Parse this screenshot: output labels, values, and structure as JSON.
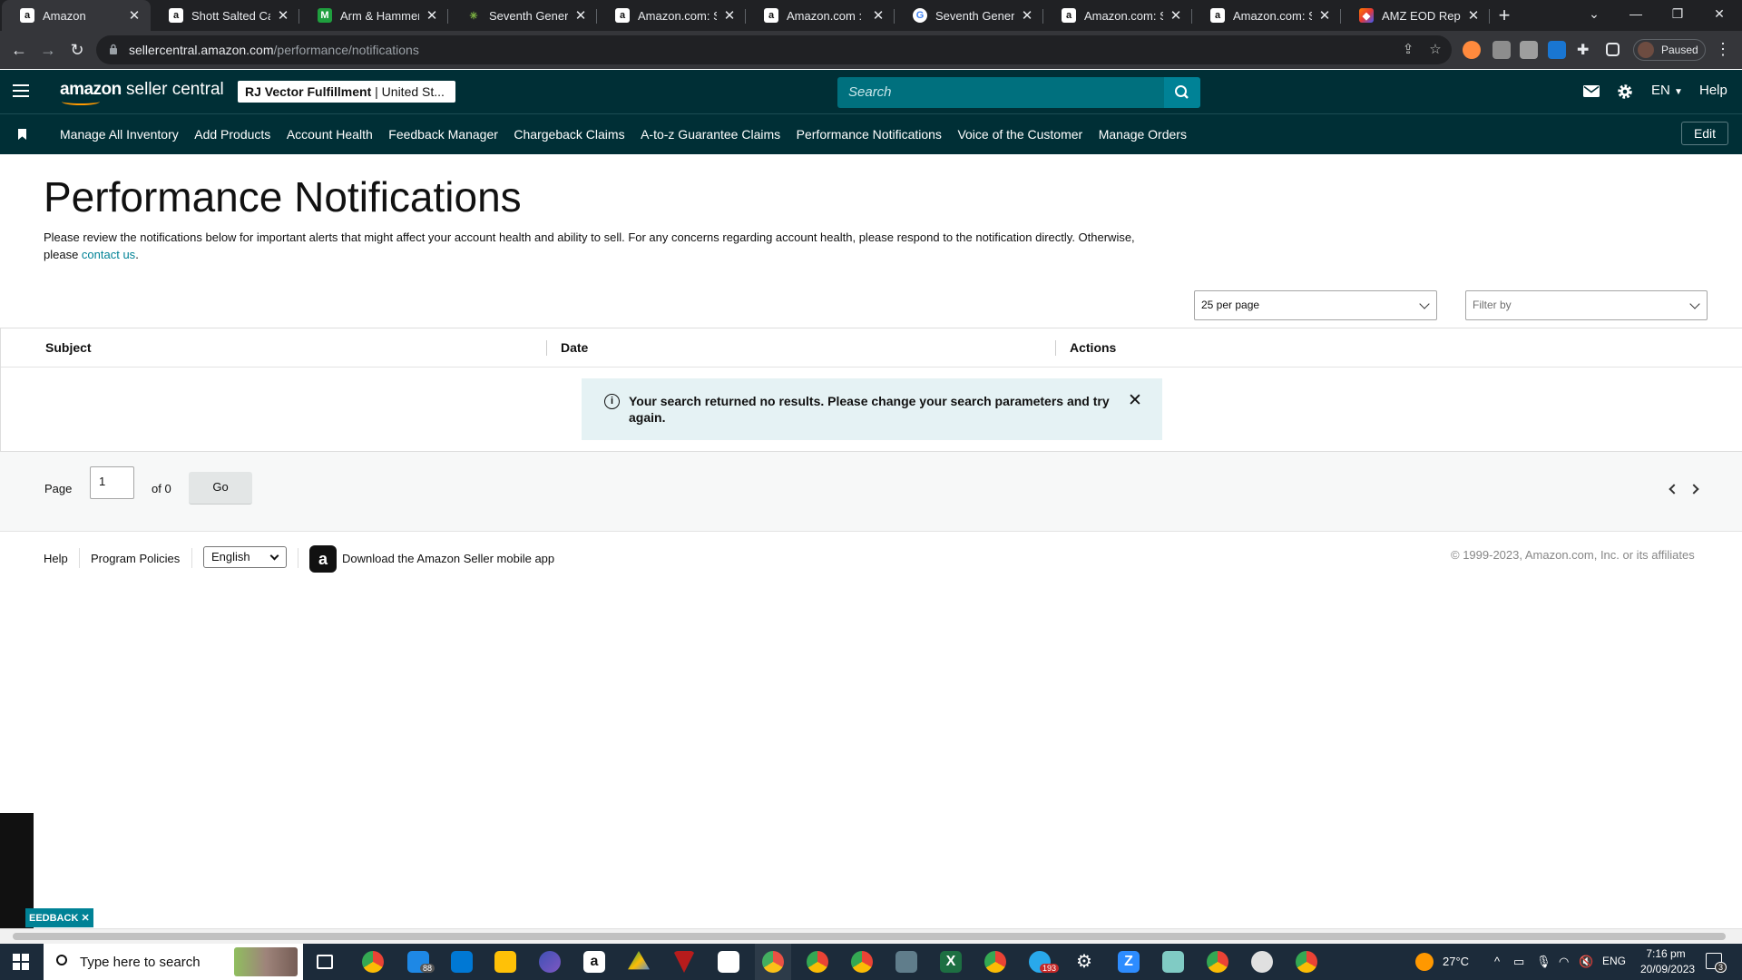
{
  "browser": {
    "tabs": [
      {
        "title": "Amazon",
        "favicon": "amazon-icon",
        "active": true
      },
      {
        "title": "Shott Salted Caram",
        "favicon": "amazon-icon"
      },
      {
        "title": "Arm & Hammer™ |",
        "favicon": "m-icon"
      },
      {
        "title": "Seventh Generatio",
        "favicon": "leaf-icon"
      },
      {
        "title": "Amazon.com: Seve",
        "favicon": "amazon-icon"
      },
      {
        "title": "Amazon.com : Seve",
        "favicon": "amazon-icon"
      },
      {
        "title": "Seventh Generatio",
        "favicon": "google-icon"
      },
      {
        "title": "Amazon.com: Sing",
        "favicon": "amazon-icon"
      },
      {
        "title": "Amazon.com: Seve",
        "favicon": "amazon-icon"
      },
      {
        "title": "AMZ EOD Report",
        "favicon": "amz-report-icon"
      }
    ],
    "close_glyph": "✕",
    "new_tab": "+",
    "url_host": "sellercentral.amazon.com",
    "url_path": "/performance/notifications",
    "profile_label": "Paused"
  },
  "header": {
    "logo_text": "amazon",
    "logo_suffix": " seller central",
    "account_name": "RJ Vector Fulfillment",
    "account_region": " | United St...",
    "search_placeholder": "Search",
    "language": "EN",
    "help": "Help"
  },
  "nav": {
    "links": [
      "Manage All Inventory",
      "Add Products",
      "Account Health",
      "Feedback Manager",
      "Chargeback Claims",
      "A-to-z Guarantee Claims",
      "Performance Notifications",
      "Voice of the Customer",
      "Manage Orders"
    ],
    "edit": "Edit"
  },
  "main": {
    "title": "Performance Notifications",
    "intro": "Please review the notifications below for important alerts that might affect your account health and ability to sell. For any concerns regarding account health, please respond to the notification directly. Otherwise, please ",
    "contact_link": "contact us",
    "intro_end": ".",
    "per_page": "25 per page",
    "filter_placeholder": "Filter by",
    "columns": [
      "Subject",
      "Date",
      "Actions"
    ],
    "alert_message": "Your search returned no results. Please change your search parameters and try again.",
    "pager": {
      "page_label": "Page",
      "page_value": "1",
      "of_label": "of 0",
      "go": "Go"
    }
  },
  "footer": {
    "help": "Help",
    "program_policies": "Program Policies",
    "language": "English",
    "download_app": "Download the Amazon Seller mobile app",
    "copyright": "© 1999-2023, Amazon.com, Inc. or its affiliates"
  },
  "feedback_tab": "EEDBACK ✕",
  "taskbar": {
    "search_placeholder": "Type here to search",
    "mail_badge": "88",
    "telegram_badge": "193",
    "temperature": "27°C",
    "input_lang": "ENG",
    "time": "7:16 pm",
    "date": "20/09/2023",
    "notif_count": "3"
  }
}
